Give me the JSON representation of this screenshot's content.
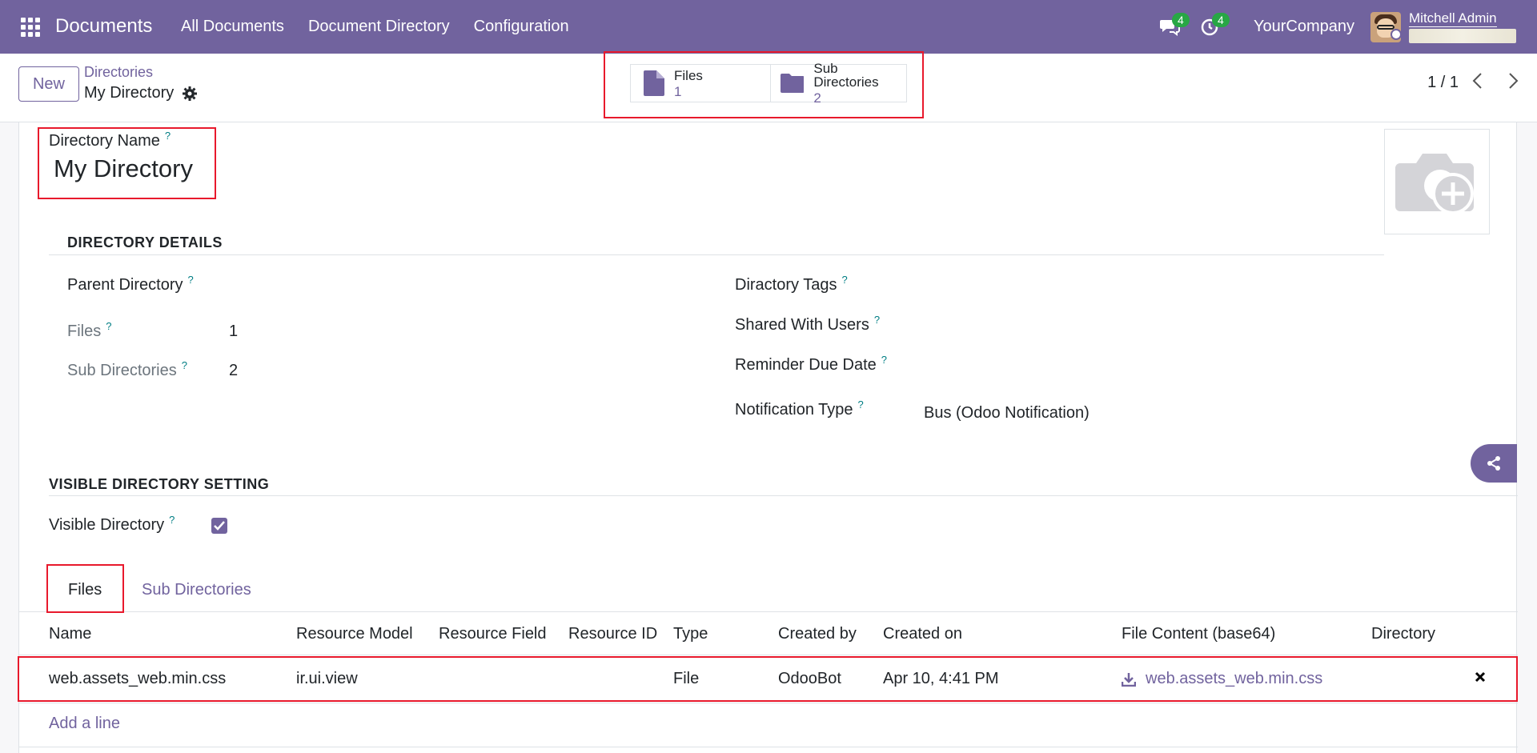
{
  "navbar": {
    "brand": "Documents",
    "menu": [
      "All Documents",
      "Document Directory",
      "Configuration"
    ],
    "messages_badge": "4",
    "activities_badge": "4",
    "company": "YourCompany",
    "user_name": "Mitchell Admin"
  },
  "control": {
    "new_label": "New",
    "breadcrumb_parent": "Directories",
    "record_title": "My Directory",
    "smart_buttons": [
      {
        "label": "Files",
        "value": "1"
      },
      {
        "label": "Sub Directories",
        "value": "2"
      }
    ],
    "pager": "1 / 1"
  },
  "form": {
    "name_label": "Directory Name",
    "name_value": "My Directory",
    "details_title": "DIRECTORY DETAILS",
    "parent_label": "Parent Directory",
    "files_label": "Files",
    "files_value": "1",
    "subdirs_label": "Sub Directories",
    "subdirs_value": "2",
    "tags_label": "Diractory Tags",
    "shared_label": "Shared With Users",
    "reminder_label": "Reminder Due Date",
    "notification_label": "Notification Type",
    "notification_value": "Bus (Odoo Notification)",
    "visible_section": "VISIBLE DIRECTORY SETTING",
    "visible_label": "Visible Directory",
    "visible_checked": true,
    "help": "?"
  },
  "tabs": {
    "files": "Files",
    "subdirs": "Sub Directories"
  },
  "table": {
    "headers": [
      "Name",
      "Resource Model",
      "Resource Field",
      "Resource ID",
      "Type",
      "Created by",
      "Created on",
      "File Content (base64)",
      "Directory"
    ],
    "rows": [
      {
        "name": "web.assets_web.min.css",
        "resource_model": "ir.ui.view",
        "resource_field": "",
        "resource_id": "",
        "type": "File",
        "created_by": "OdooBot",
        "created_on": "Apr 10, 4:41 PM",
        "file_content": "web.assets_web.min.css",
        "directory": ""
      }
    ],
    "add_line": "Add a line"
  },
  "colors": {
    "brand": "#71639e",
    "badge": "#28a745",
    "highlight": "#e8192c",
    "help": "#017e84"
  },
  "icons": [
    "apps-grid-icon",
    "chat-icon",
    "clock-icon",
    "gear-icon",
    "file-icon",
    "folder-icon",
    "camera-add-icon",
    "share-icon",
    "download-icon",
    "close-icon",
    "chevron-left-icon",
    "chevron-right-icon",
    "check-icon"
  ]
}
